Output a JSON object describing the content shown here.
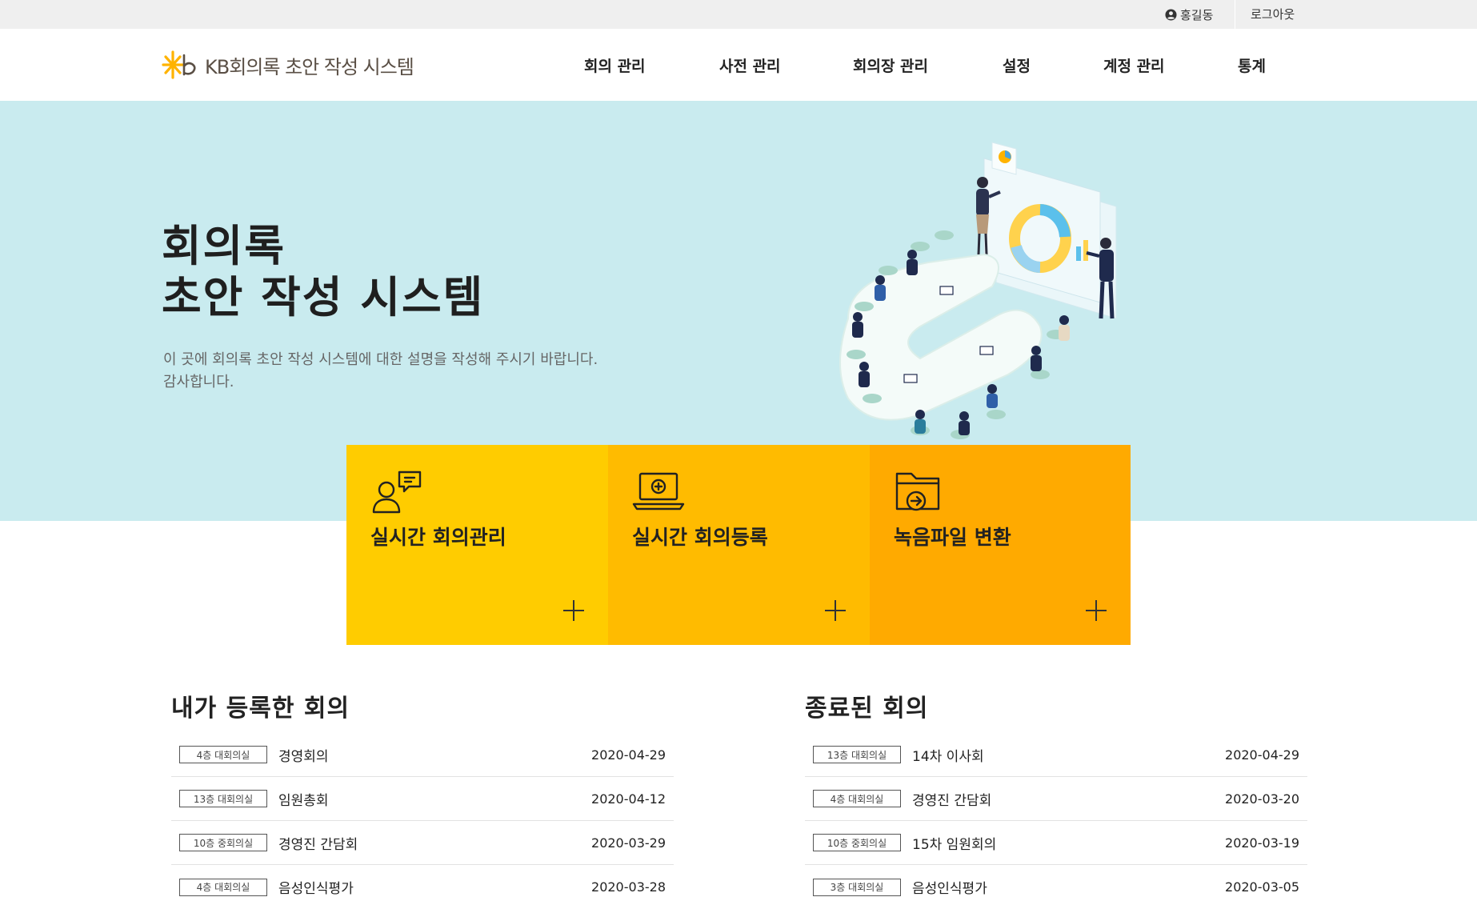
{
  "topbar": {
    "user_name": "홍길동",
    "logout_label": "로그아웃"
  },
  "header": {
    "logo_text": "KB회의록 초안 작성 시스템",
    "nav": [
      "회의 관리",
      "사전 관리",
      "회의장 관리",
      "설정",
      "계정 관리",
      "통계"
    ]
  },
  "hero": {
    "title_line1": "회의록",
    "title_line2": "초안 작성 시스템",
    "desc_line1": "이 곳에 회의록 초안 작성 시스템에 대한 설명을 작성해 주시기 바랍니다.",
    "desc_line2": "감사합니다."
  },
  "tiles": [
    {
      "label": "실시간 회의관리",
      "icon": "person-chat-icon"
    },
    {
      "label": "실시간 회의등록",
      "icon": "laptop-plus-icon"
    },
    {
      "label": "녹음파일 변환",
      "icon": "folder-arrow-icon"
    }
  ],
  "my_meetings": {
    "title": "내가 등록한 회의",
    "items": [
      {
        "room": "4층 대회의실",
        "title": "경영회의",
        "date": "2020-04-29"
      },
      {
        "room": "13층 대회의실",
        "title": "임원총회",
        "date": "2020-04-12"
      },
      {
        "room": "10층 중회의실",
        "title": "경영진 간담회",
        "date": "2020-03-29"
      },
      {
        "room": "4층 대회의실",
        "title": "음성인식평가",
        "date": "2020-03-28"
      }
    ]
  },
  "ended_meetings": {
    "title": "종료된 회의",
    "items": [
      {
        "room": "13층 대회의실",
        "title": "14차 이사회",
        "date": "2020-04-29"
      },
      {
        "room": "4층 대회의실",
        "title": "경영진 간담회",
        "date": "2020-03-20"
      },
      {
        "room": "10층 중회의실",
        "title": "15차 임원회의",
        "date": "2020-03-19"
      },
      {
        "room": "3층 대회의실",
        "title": "음성인식평가",
        "date": "2020-03-05"
      }
    ]
  },
  "colors": {
    "hero_bg": "#c9ebef",
    "tile1": "#ffcc00",
    "tile2": "#ffbb00",
    "tile3": "#ffaa00",
    "brand": "#ffb300"
  }
}
